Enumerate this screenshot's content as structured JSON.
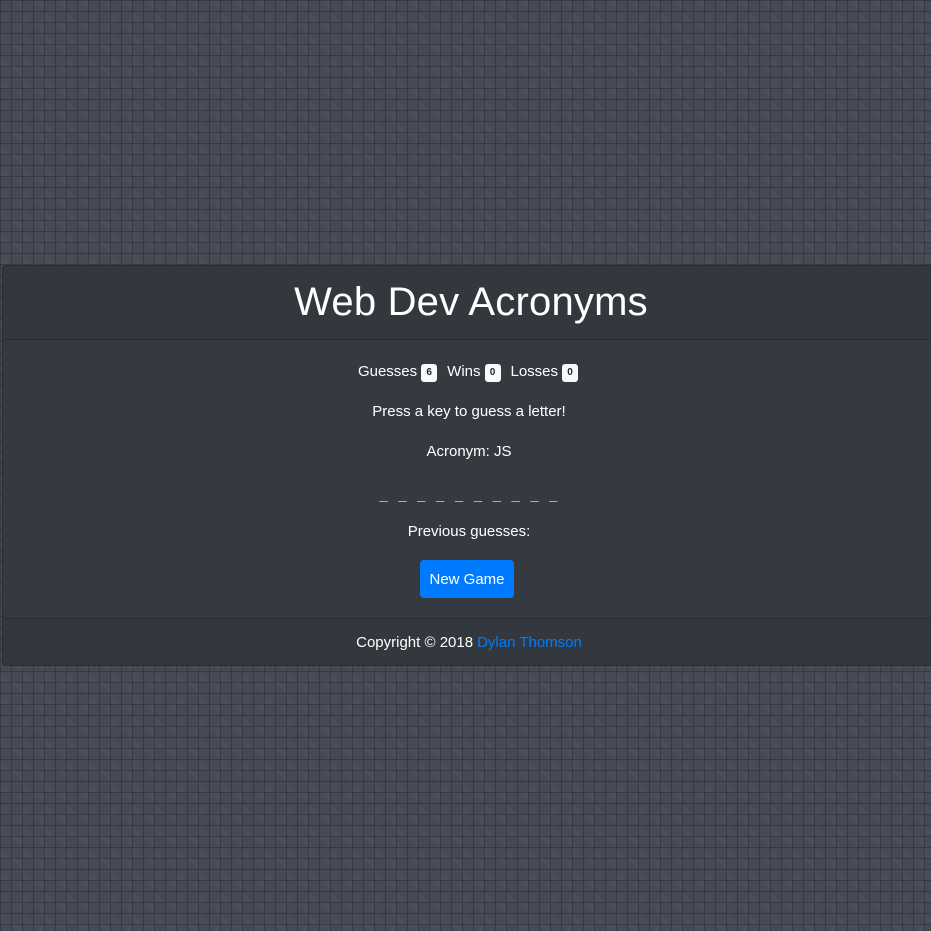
{
  "header": {
    "title": "Web Dev Acronyms"
  },
  "stats": {
    "guesses_label": "Guesses",
    "guesses_value": "6",
    "wins_label": "Wins",
    "wins_value": "0",
    "losses_label": "Losses",
    "losses_value": "0"
  },
  "game": {
    "prompt": "Press a key to guess a letter!",
    "acronym": "Acronym: JS",
    "blanks": "_ _ _ _ _ _ _ _ _ _",
    "previous_guesses": "Previous guesses:",
    "new_game_label": "New Game"
  },
  "footer": {
    "copyright": "Copyright © 2018",
    "author": "Dylan Thomson"
  },
  "colors": {
    "background": "#454a54",
    "card": "#343a40",
    "accent": "#007bff",
    "badge": "#f8f9fa"
  }
}
